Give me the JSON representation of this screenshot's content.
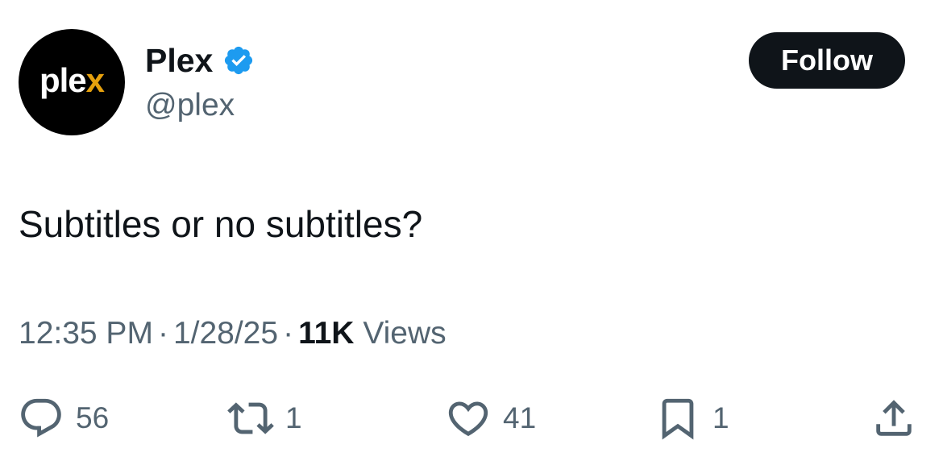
{
  "account": {
    "display_name": "Plex",
    "handle": "@plex",
    "avatar_logo_text": "plex",
    "verified": true
  },
  "follow_button": {
    "label": "Follow"
  },
  "tweet": {
    "text": "Subtitles or no subtitles?",
    "time": "12:35 PM",
    "date": "1/28/25",
    "separator": "·",
    "views_count": "11K",
    "views_label": "Views"
  },
  "actions": {
    "replies": "56",
    "reposts": "1",
    "likes": "41",
    "bookmarks": "1"
  },
  "icons": {
    "reply": "reply-icon",
    "repost": "repost-icon",
    "like": "like-icon",
    "bookmark": "bookmark-icon",
    "share": "share-icon",
    "verified": "verified-badge-icon"
  },
  "colors": {
    "verified_blue": "#1d9bf0",
    "text_primary": "#0f1419",
    "text_secondary": "#536471",
    "plex_orange": "#e5a00d",
    "button_bg": "#0f1419"
  }
}
